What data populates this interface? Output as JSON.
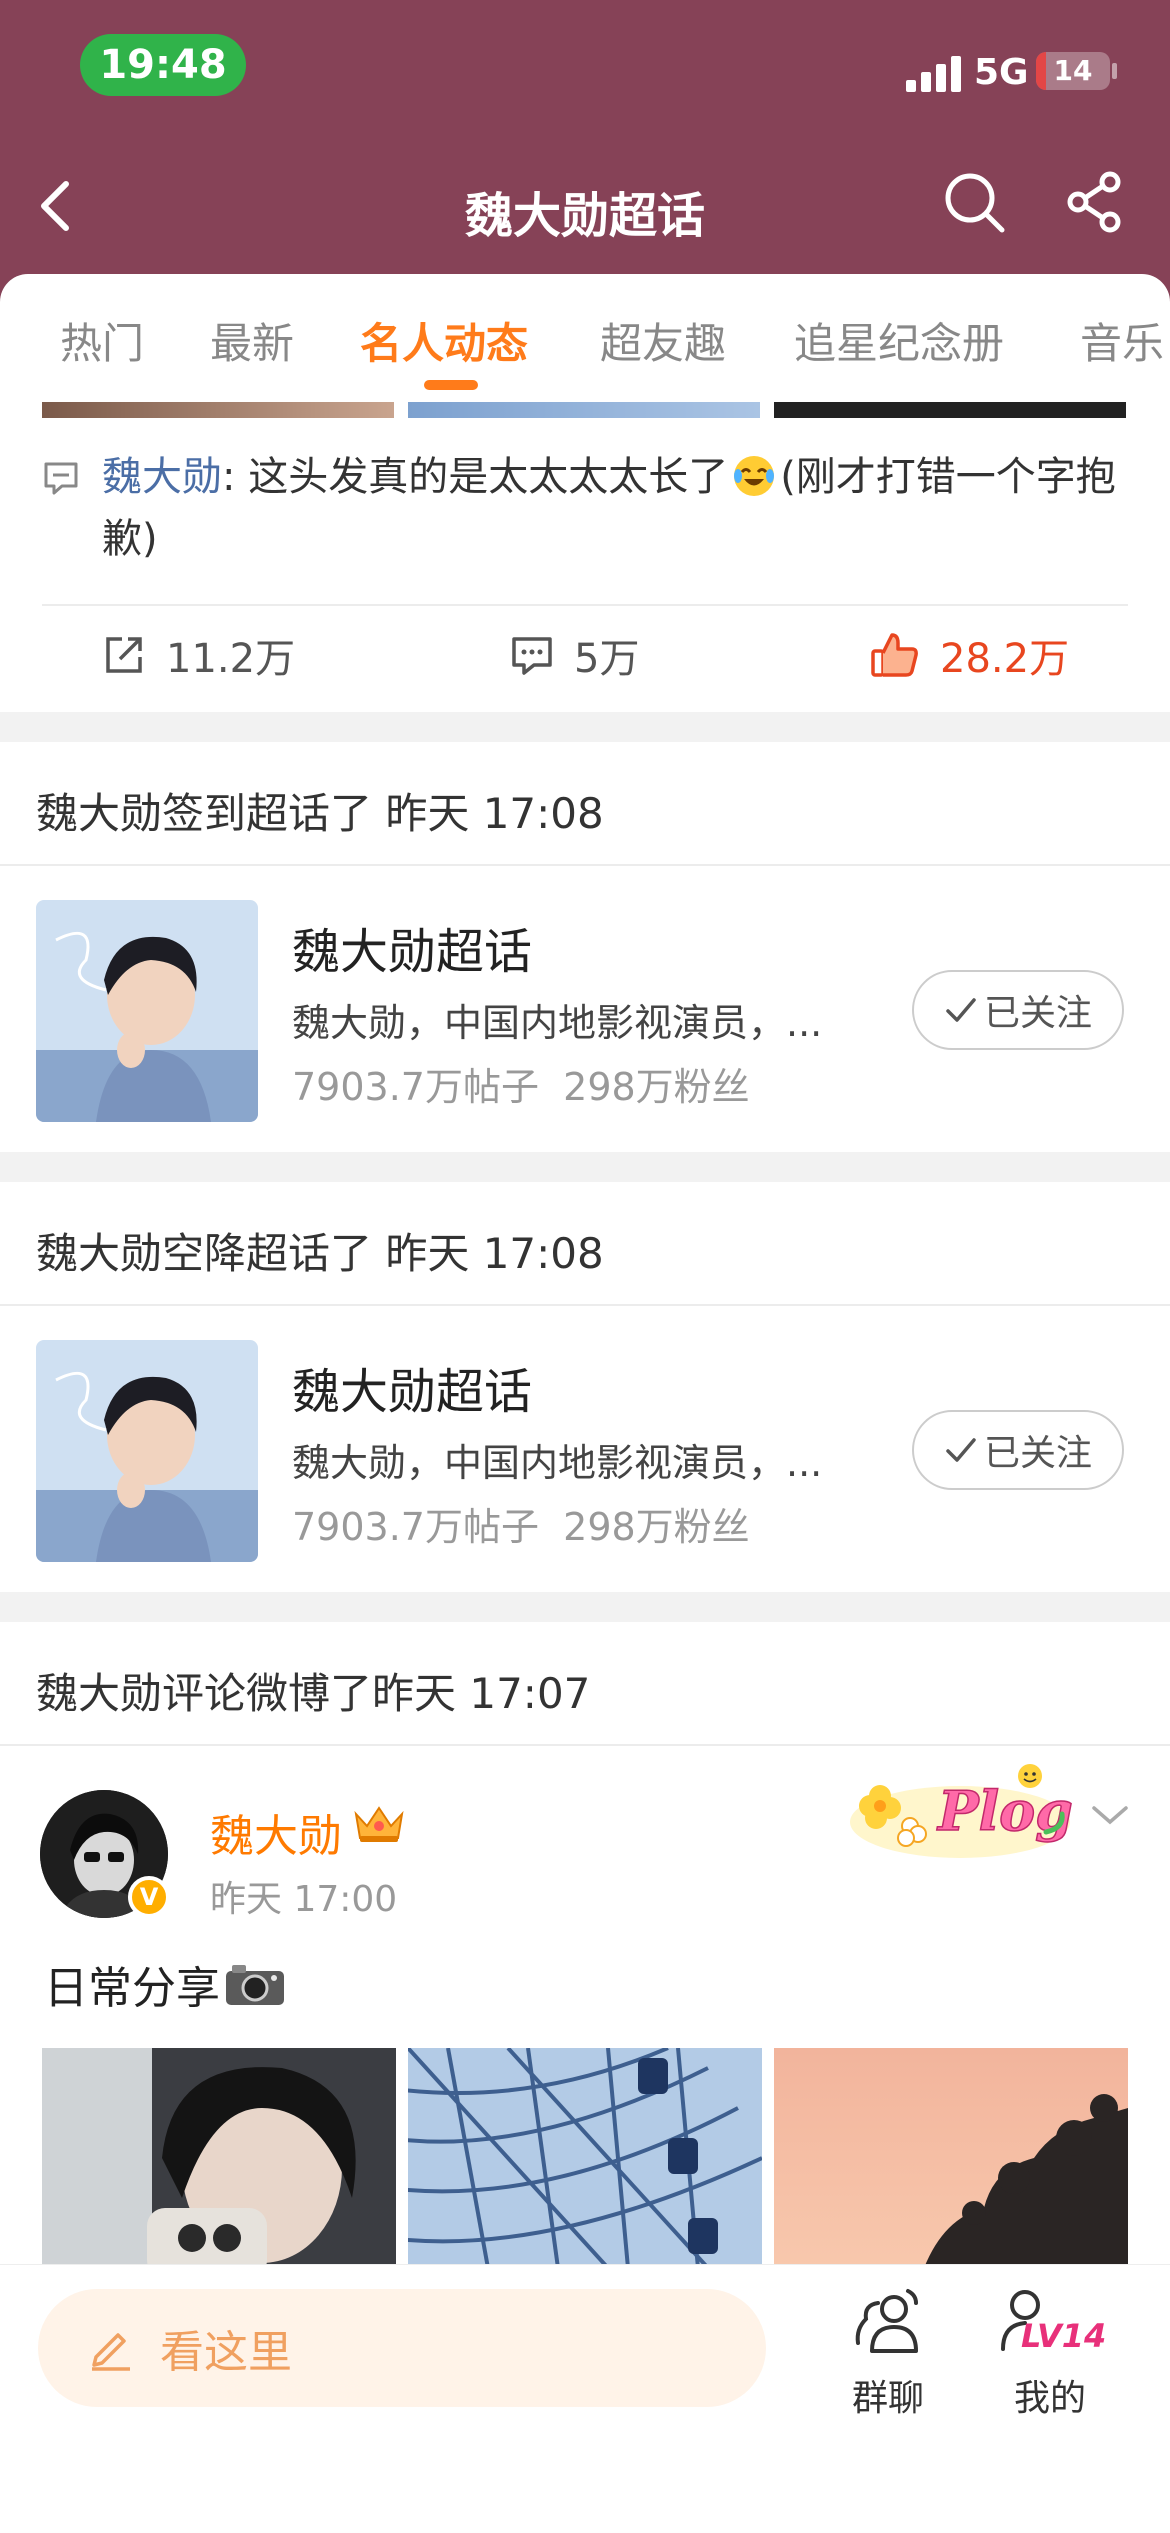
{
  "status_bar": {
    "time": "19:48",
    "network": "5G",
    "battery": "14",
    "battery_level": 0.14
  },
  "header": {
    "title": "魏大勋超话"
  },
  "tabs": [
    {
      "label": "热门"
    },
    {
      "label": "最新"
    },
    {
      "label": "名人动态"
    },
    {
      "label": "超友趣"
    },
    {
      "label": "追星纪念册"
    },
    {
      "label": "音乐"
    }
  ],
  "active_tab": "名人动态",
  "post_fragment": {
    "author": "魏大勋",
    "separator": ": ",
    "text": "这头发真的是太太太太长了",
    "text_tail": "(刚才打错一个字抱歉)",
    "emoji": "laughing-tears-icon",
    "repost_count": "11.2万",
    "comment_count": "5万",
    "like_count": "28.2万"
  },
  "activities": [
    {
      "title": "魏大勋签到超话了 昨天 17:08",
      "topic_name": "魏大勋超话",
      "topic_desc": "魏大勋，中国内地影视演员，...",
      "topic_posts": "7903.7万帖子",
      "topic_fans": "298万粉丝",
      "follow_label": "已关注"
    },
    {
      "title": "魏大勋空降超话了 昨天 17:08",
      "topic_name": "魏大勋超话",
      "topic_desc": "魏大勋，中国内地影视演员，...",
      "topic_posts": "7903.7万帖子",
      "topic_fans": "298万粉丝",
      "follow_label": "已关注"
    }
  ],
  "comment_activity": {
    "title": "魏大勋评论微博了昨天 17:07",
    "author": "魏大勋",
    "time": "昨天 17:00",
    "text": "日常分享",
    "badge_text": "Plog"
  },
  "bottom_bar": {
    "compose_placeholder": "看这里",
    "group_chat": "群聊",
    "mine": "我的",
    "level": "LV14"
  },
  "colors": {
    "header_bg": "#864257",
    "accent": "#ff7b1a",
    "like": "#e8461f",
    "link": "#4b6ea6"
  }
}
